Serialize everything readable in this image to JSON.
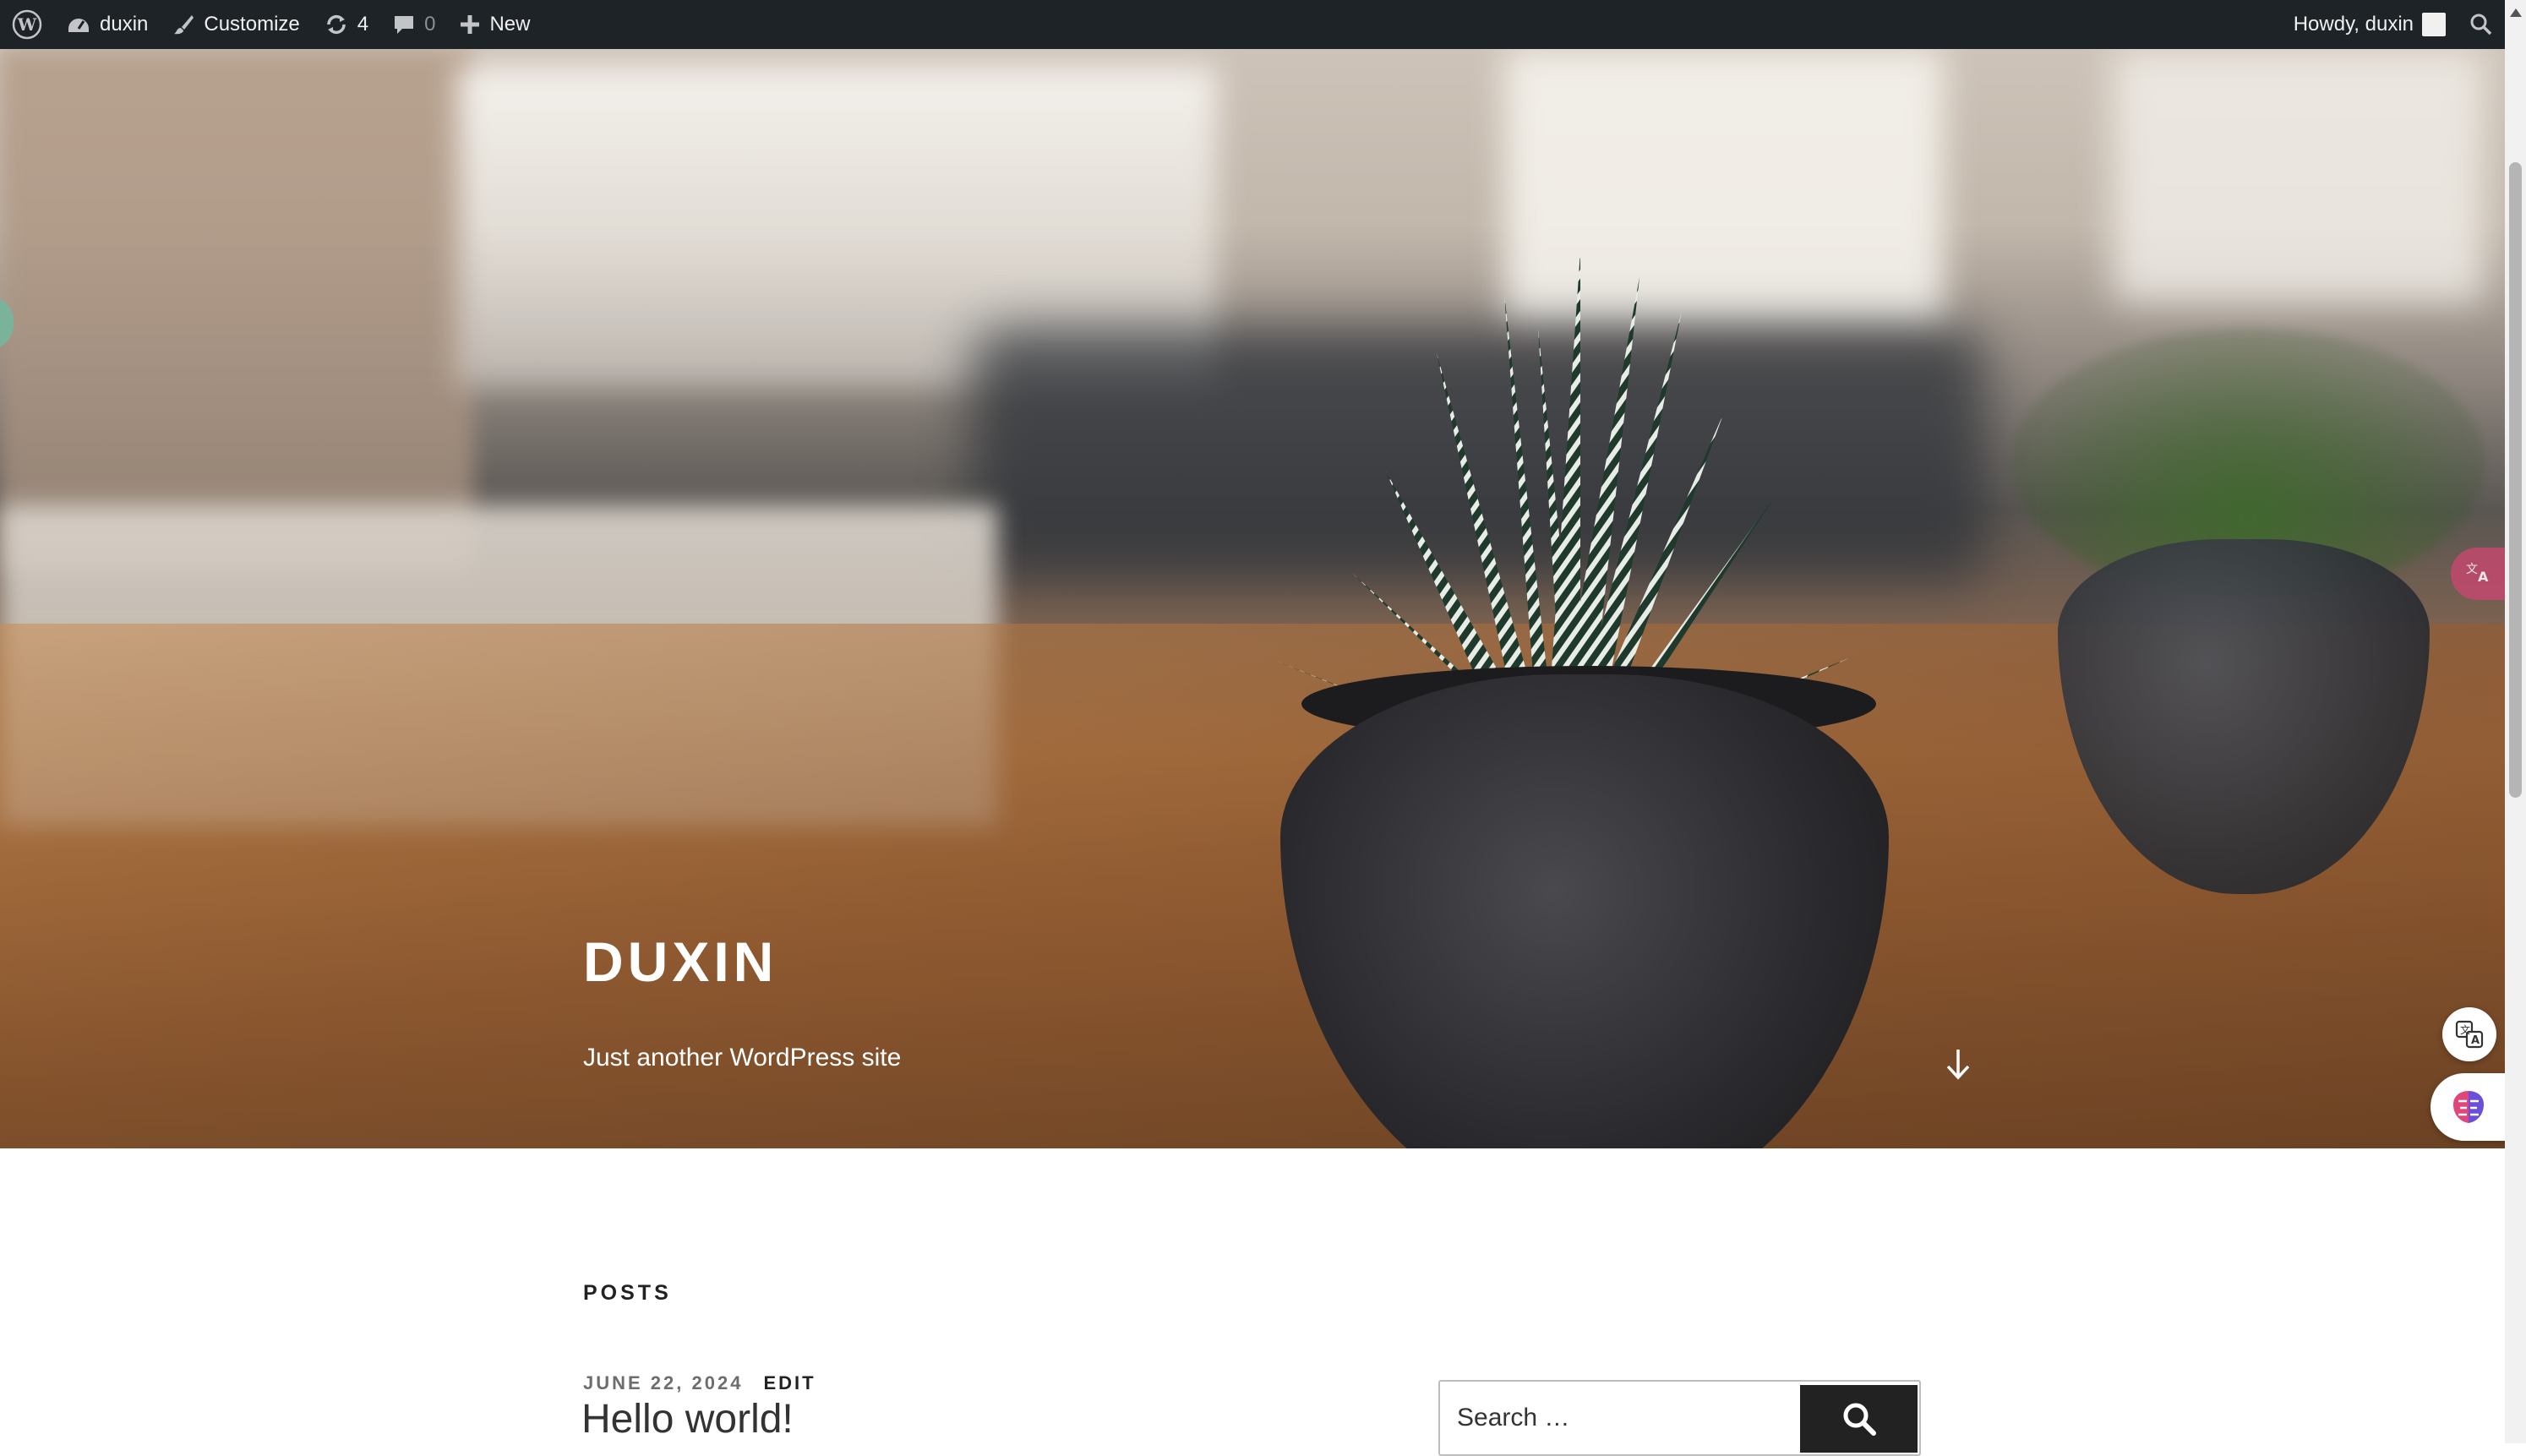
{
  "adminbar": {
    "wp_logo_icon": "wordpress-icon",
    "site_name": "duxin",
    "customize_label": "Customize",
    "updates_count": "4",
    "comments_count": "0",
    "new_label": "New",
    "howdy_label": "Howdy, duxin"
  },
  "hero": {
    "site_title": "DUXIN",
    "tagline": "Just another WordPress site"
  },
  "content": {
    "posts_heading": "POSTS",
    "post": {
      "date": "JUNE 22, 2024",
      "edit_label": "EDIT",
      "title": "Hello world!"
    },
    "search": {
      "placeholder": "Search …"
    }
  },
  "colors": {
    "adminbar_bg": "#1d2327",
    "adminbar_text": "#f0f0f1",
    "search_button": "#222222",
    "translate_pill": "#c2496e"
  }
}
